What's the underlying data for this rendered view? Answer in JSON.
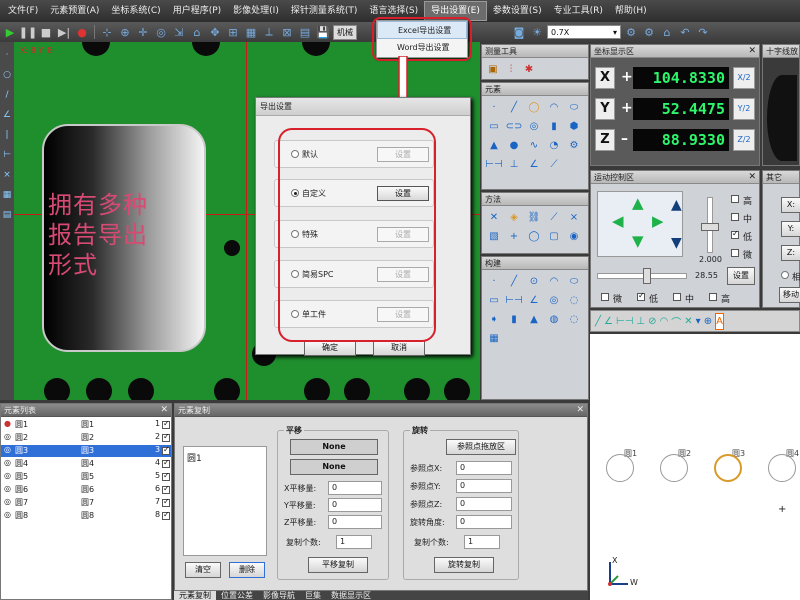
{
  "menubar": {
    "items": [
      "文件(F)",
      "元素预置(A)",
      "坐标系统(C)",
      "用户程序(P)",
      "影像处理(I)",
      "探针测量系统(T)",
      "语言选择(S)",
      "导出设置(E)",
      "参数设置(S)",
      "专业工具(R)",
      "帮助(H)"
    ],
    "active_index": 7
  },
  "toolbar": {
    "machine_label": "机械",
    "zoom_value": "0.7X"
  },
  "export_menu": {
    "items": [
      "Excel导出设置",
      "Word导出设置"
    ],
    "highlighted_index": 0
  },
  "viewport": {
    "overlay_text_line1": "拥有多种",
    "overlay_text_line2": "报告导出",
    "overlay_text_line3": "形式",
    "corner_coord": "X: 8    Y: 8"
  },
  "export_dialog": {
    "title": "导出设置",
    "options": [
      {
        "label": "默认",
        "button": "设置",
        "selected": false,
        "enabled": false
      },
      {
        "label": "自定义",
        "button": "设置",
        "selected": true,
        "enabled": true
      },
      {
        "label": "特殊",
        "button": "设置",
        "selected": false,
        "enabled": false
      },
      {
        "label": "简易SPC",
        "button": "设置",
        "selected": false,
        "enabled": false
      },
      {
        "label": "单工件",
        "button": "设置",
        "selected": false,
        "enabled": false
      }
    ],
    "ok_label": "确定",
    "cancel_label": "取消"
  },
  "measure_tools": {
    "title": "测量工具"
  },
  "elements_panel": {
    "title": "元素"
  },
  "method_panel": {
    "title": "方法"
  },
  "construct_panel": {
    "title": "构建"
  },
  "coord_panel": {
    "title": "坐标显示区",
    "rows": [
      {
        "axis": "X",
        "sign": "+",
        "value": "104.8330",
        "half": "X/2"
      },
      {
        "axis": "Y",
        "sign": "+",
        "value": "52.4475",
        "half": "Y/2"
      },
      {
        "axis": "Z",
        "sign": "–",
        "value": "88.9330",
        "half": "Z/2"
      }
    ]
  },
  "crosshair_panel": {
    "title": "十字线放"
  },
  "motion_panel": {
    "title": "运动控制区",
    "speed_value": "2.000",
    "slider_value": "28.55",
    "speed_checks": [
      "高",
      "中",
      "低",
      "微"
    ],
    "speed_checked": "低",
    "bottom_checks": [
      "微",
      "低",
      "中",
      "高"
    ],
    "bottom_checked": "低",
    "set_label": "设置"
  },
  "other_panel": {
    "title": "其它",
    "x_label": "X:",
    "y_label": "Y:",
    "z_label": "Z:",
    "relative_label": "相",
    "move_label": "移动"
  },
  "element_list": {
    "title": "元素列表",
    "rows": [
      {
        "name": "圆1",
        "dup": "圆1",
        "num": "1"
      },
      {
        "name": "圆2",
        "dup": "圆2",
        "num": "2"
      },
      {
        "name": "圆3",
        "dup": "圆3",
        "num": "3"
      },
      {
        "name": "圆4",
        "dup": "圆4",
        "num": "4"
      },
      {
        "name": "圆5",
        "dup": "圆5",
        "num": "5"
      },
      {
        "name": "圆6",
        "dup": "圆6",
        "num": "6"
      },
      {
        "name": "圆7",
        "dup": "圆7",
        "num": "7"
      },
      {
        "name": "圆8",
        "dup": "圆8",
        "num": "8"
      }
    ]
  },
  "element_copy": {
    "title": "元素复制",
    "list_item": "圆1",
    "clear_label": "清空",
    "delete_label": "删除",
    "translate": {
      "title": "平移",
      "none1": "None",
      "none2": "None",
      "dx_label": "X平移量:",
      "dx": "0",
      "dy_label": "Y平移量:",
      "dy": "0",
      "dz_label": "Z平移量:",
      "dz": "0",
      "count_label": "复制个数:",
      "count": "1",
      "button": "平移复制"
    },
    "rotate": {
      "title": "旋转",
      "ref_area": "参照点拖放区",
      "px_label": "参照点X:",
      "px": "0",
      "py_label": "参照点Y:",
      "py": "0",
      "pz_label": "参照点Z:",
      "pz": "0",
      "angle_label": "旋转角度:",
      "angle": "0",
      "count_label": "复制个数:",
      "count": "1",
      "button": "旋转复制"
    }
  },
  "bottom_tabs": [
    "元素复制",
    "位置公差",
    "影像导航",
    "巨集",
    "数据显示区"
  ],
  "canvas2": {
    "circle_labels": [
      "圆1",
      "圆2",
      "圆3",
      "圆4"
    ],
    "axis_x": "W",
    "axis_y": "X"
  },
  "colors": {
    "lcd_text": "#2ef56b",
    "annotation_red": "#d8202c",
    "overlay_text": "#d64a74",
    "viewport_green": "#1f8f2e",
    "selected_circle": "#d99a2b"
  }
}
